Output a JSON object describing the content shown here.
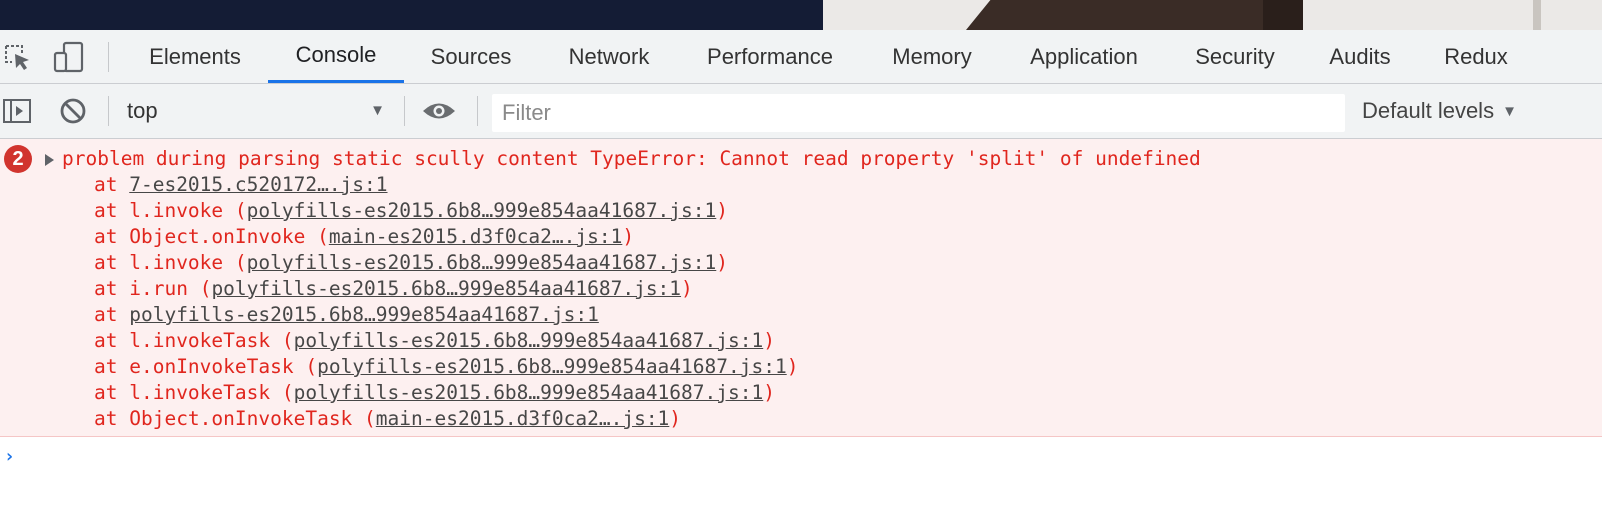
{
  "tabs": [
    {
      "label": "Elements",
      "active": false
    },
    {
      "label": "Console",
      "active": true
    },
    {
      "label": "Sources",
      "active": false
    },
    {
      "label": "Network",
      "active": false
    },
    {
      "label": "Performance",
      "active": false
    },
    {
      "label": "Memory",
      "active": false
    },
    {
      "label": "Application",
      "active": false
    },
    {
      "label": "Security",
      "active": false
    },
    {
      "label": "Audits",
      "active": false
    },
    {
      "label": "Redux",
      "active": false
    }
  ],
  "toolbar": {
    "context": "top",
    "filter_placeholder": "Filter",
    "filter_value": "",
    "levels": "Default levels"
  },
  "error": {
    "count": "2",
    "message": "problem during parsing static scully content TypeError: Cannot read property 'split' of undefined",
    "stack": [
      {
        "prefix": "at ",
        "fn": "",
        "open": "",
        "link": "7-es2015.c520172….js:1",
        "close": ""
      },
      {
        "prefix": "at ",
        "fn": "l.invoke ",
        "open": "(",
        "link": "polyfills-es2015.6b8…999e854aa41687.js:1",
        "close": ")"
      },
      {
        "prefix": "at ",
        "fn": "Object.onInvoke ",
        "open": "(",
        "link": "main-es2015.d3f0ca2….js:1",
        "close": ")"
      },
      {
        "prefix": "at ",
        "fn": "l.invoke ",
        "open": "(",
        "link": "polyfills-es2015.6b8…999e854aa41687.js:1",
        "close": ")"
      },
      {
        "prefix": "at ",
        "fn": "i.run ",
        "open": "(",
        "link": "polyfills-es2015.6b8…999e854aa41687.js:1",
        "close": ")"
      },
      {
        "prefix": "at ",
        "fn": "",
        "open": "",
        "link": "polyfills-es2015.6b8…999e854aa41687.js:1",
        "close": ""
      },
      {
        "prefix": "at ",
        "fn": "l.invokeTask ",
        "open": "(",
        "link": "polyfills-es2015.6b8…999e854aa41687.js:1",
        "close": ")"
      },
      {
        "prefix": "at ",
        "fn": "e.onInvokeTask ",
        "open": "(",
        "link": "polyfills-es2015.6b8…999e854aa41687.js:1",
        "close": ")"
      },
      {
        "prefix": "at ",
        "fn": "l.invokeTask ",
        "open": "(",
        "link": "polyfills-es2015.6b8…999e854aa41687.js:1",
        "close": ")"
      },
      {
        "prefix": "at ",
        "fn": "Object.onInvokeTask ",
        "open": "(",
        "link": "main-es2015.d3f0ca2….js:1",
        "close": ")"
      }
    ]
  },
  "prompt": "›",
  "colors": {
    "error_text": "#e0261e",
    "error_bg": "#fdf0f0",
    "active_tab": "#1a73e8",
    "badge": "#d1342e"
  }
}
